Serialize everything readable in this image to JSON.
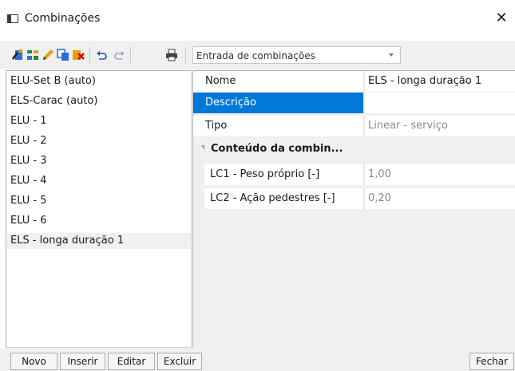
{
  "window": {
    "title": "Combinações",
    "close_glyph": "✕"
  },
  "toolbar": {
    "icons": [
      "new-combination-icon",
      "generate-combinations-icon",
      "edit-pencil-icon",
      "copy-icon",
      "delete-icon",
      "undo-icon",
      "redo-icon",
      "print-icon"
    ],
    "combo_value": "Entrada de combinações"
  },
  "combinations": [
    "ELU-Set B (auto)",
    "ELS-Carac (auto)",
    "ELU - 1",
    "ELU - 2",
    "ELU - 3",
    "ELU - 4",
    "ELU - 5",
    "ELU - 6",
    "ELS - longa duração 1"
  ],
  "selected_combination_index": 8,
  "properties": {
    "nome": {
      "label": "Nome",
      "value": "ELS - longa duração 1"
    },
    "descricao": {
      "label": "Descrição",
      "value": ""
    },
    "tipo": {
      "label": "Tipo",
      "value": "Linear - serviço"
    },
    "category": {
      "label": "Conteúdo da combin..."
    },
    "lc1": {
      "label": "LC1 - Peso próprio [-]",
      "value": "1,00"
    },
    "lc2": {
      "label": "LC2 - Ação pedestres [-]",
      "value": "0,20"
    }
  },
  "buttons": {
    "novo": "Novo",
    "inserir": "Inserir",
    "editar": "Editar",
    "excluir": "Excluir",
    "fechar": "Fechar"
  },
  "colors": {
    "selection": "#0078d7",
    "panel_bg": "#f0f0f0"
  }
}
